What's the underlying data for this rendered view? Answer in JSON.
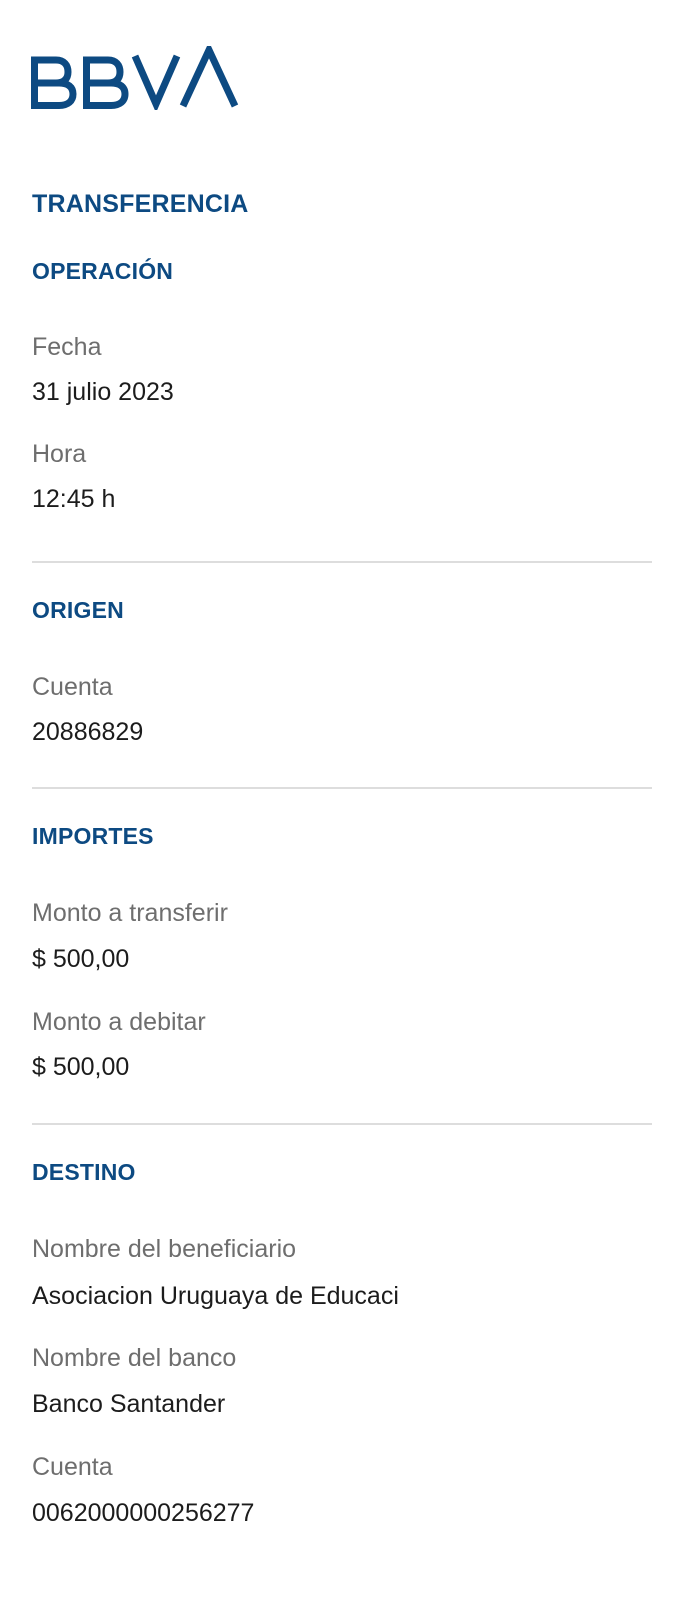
{
  "brand": {
    "logo_text": "BBVA",
    "color": "#0d4a82"
  },
  "title": "TRANSFERENCIA",
  "operacion": {
    "heading": "OPERACIÓN",
    "fecha_label": "Fecha",
    "fecha_value": "31 julio 2023",
    "hora_label": "Hora",
    "hora_value": "12:45 h"
  },
  "origen": {
    "heading": "ORIGEN",
    "cuenta_label": "Cuenta",
    "cuenta_value": "20886829"
  },
  "importes": {
    "heading": "IMPORTES",
    "monto_transferir_label": "Monto a transferir",
    "monto_transferir_value": "$ 500,00",
    "monto_debitar_label": "Monto a debitar",
    "monto_debitar_value": "$ 500,00"
  },
  "destino": {
    "heading": "DESTINO",
    "beneficiario_label": "Nombre del beneficiario",
    "beneficiario_value": "Asociacion Uruguaya de Educaci",
    "banco_label": "Nombre del banco",
    "banco_value": "Banco Santander",
    "cuenta_label": "Cuenta",
    "cuenta_value": "0062000000256277"
  }
}
